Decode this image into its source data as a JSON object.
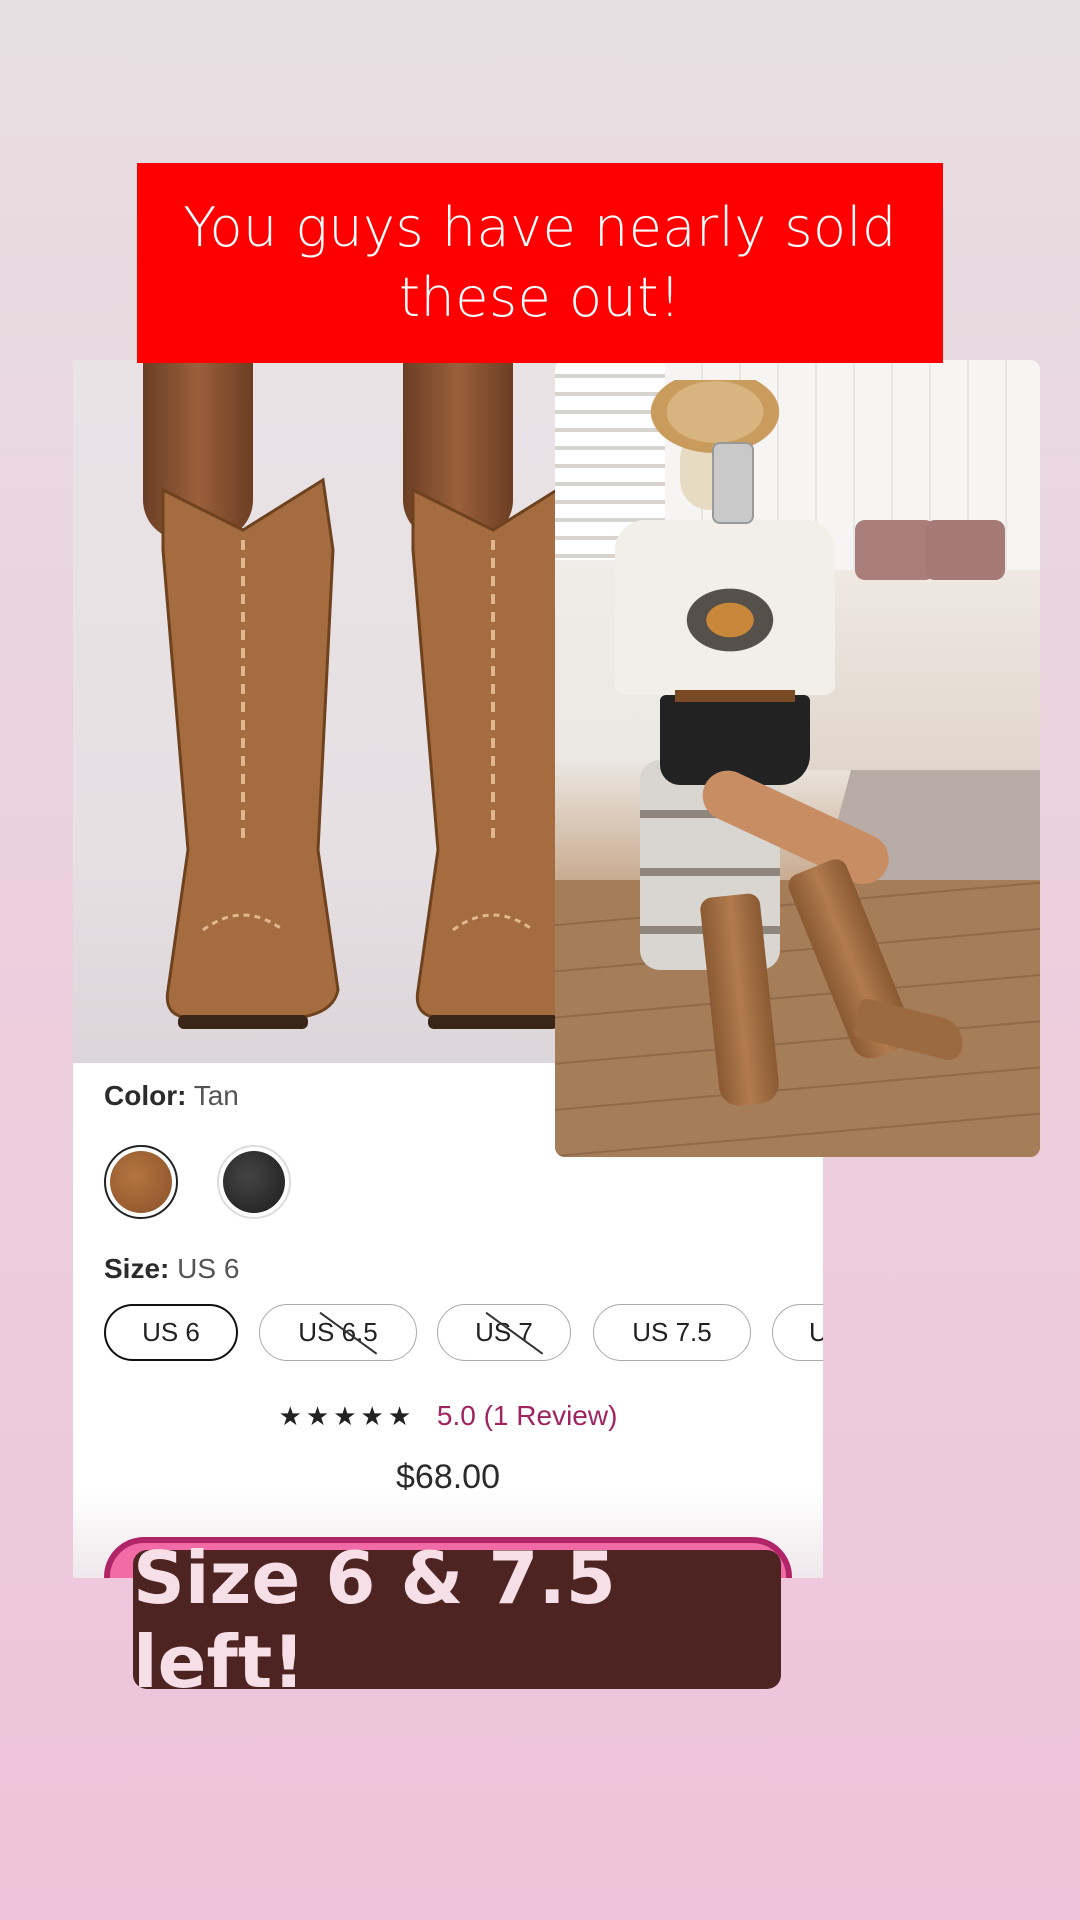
{
  "banner": {
    "text": "You guys have nearly sold these out!"
  },
  "product": {
    "color_label": "Color:",
    "color_value": "Tan",
    "swatches": [
      {
        "name": "Tan",
        "selected": true
      },
      {
        "name": "Black",
        "selected": false
      }
    ],
    "size_label": "Size:",
    "size_value": "US 6",
    "sizes": [
      {
        "label": "US 6",
        "selected": true,
        "sold_out": false
      },
      {
        "label": "US 6.5",
        "selected": false,
        "sold_out": true
      },
      {
        "label": "US 7",
        "selected": false,
        "sold_out": true
      },
      {
        "label": "US 7.5",
        "selected": false,
        "sold_out": false
      },
      {
        "label": "U",
        "selected": false,
        "sold_out": false
      }
    ],
    "stars": "★★★★★",
    "rating_text": "5.0 (1 Review)",
    "price": "$68.00"
  },
  "bottom_label": {
    "text": "Size 6 & 7.5 left!"
  },
  "colors": {
    "banner_bg": "#ff0000",
    "label_bg": "#4e2422",
    "review_link": "#a0245f"
  }
}
